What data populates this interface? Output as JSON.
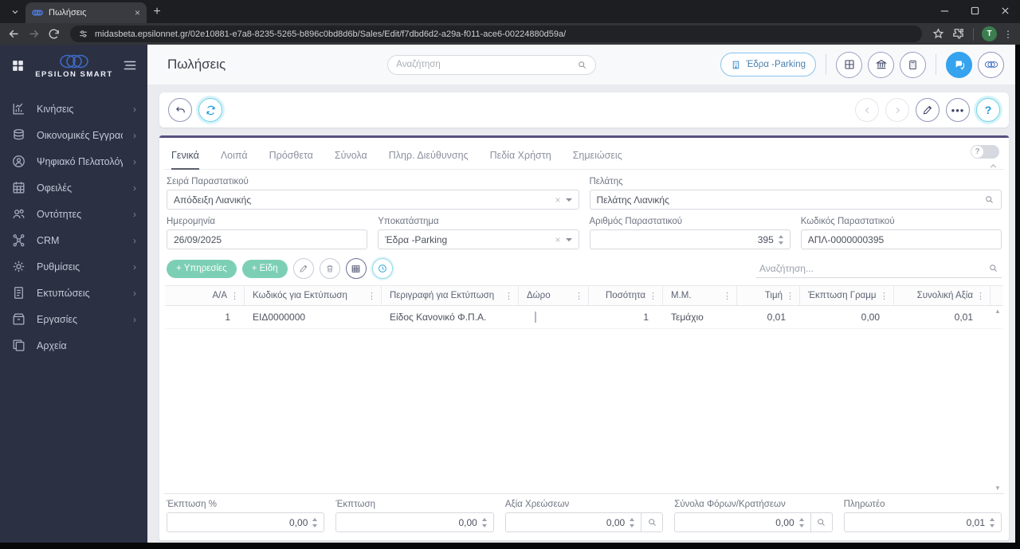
{
  "colors": {
    "accent_blue": "#35a3ee",
    "teal": "#7ccfb4",
    "sidebar_bg": "#2b3043",
    "purple_border": "#55517e"
  },
  "browser": {
    "tab_title": "Πωλήσεις",
    "url": "midasbeta.epsilonnet.gr/02e10881-e7a8-8235-5265-b896c0bd8d6b/Sales/Edit/f7dbd6d2-a29a-f011-ace6-00224880d59a/",
    "profile_initial": "T"
  },
  "sidebar": {
    "brand": "EPSILON SMART",
    "items": [
      {
        "label": "Κινήσεις"
      },
      {
        "label": "Οικονομικές Εγγραφές"
      },
      {
        "label": "Ψηφιακό Πελατολόγιο"
      },
      {
        "label": "Οφειλές"
      },
      {
        "label": "Οντότητες"
      },
      {
        "label": "CRM"
      },
      {
        "label": "Ρυθμίσεις"
      },
      {
        "label": "Εκτυπώσεις"
      },
      {
        "label": "Εργασίες"
      },
      {
        "label": "Αρχεία"
      }
    ]
  },
  "header": {
    "title": "Πωλήσεις",
    "search_placeholder": "Αναζήτηση",
    "branch_button": "Έδρα -Parking"
  },
  "tabs": [
    {
      "label": "Γενικά"
    },
    {
      "label": "Λοιπά"
    },
    {
      "label": "Πρόσθετα"
    },
    {
      "label": "Σύνολα"
    },
    {
      "label": "Πληρ. Διεύθυνσης"
    },
    {
      "label": "Πεδία Χρήστη"
    },
    {
      "label": "Σημειώσεις"
    }
  ],
  "fields": {
    "series": {
      "label": "Σειρά Παραστατικού",
      "value": "Απόδειξη Λιανικής"
    },
    "customer": {
      "label": "Πελάτης",
      "value": "Πελάτης Λιανικής"
    },
    "date": {
      "label": "Ημερομηνία",
      "value": "26/09/2025"
    },
    "branch": {
      "label": "Υποκατάστημα",
      "value": "Έδρα -Parking"
    },
    "doc_number": {
      "label": "Αριθμός Παραστατικού",
      "value": "395"
    },
    "doc_code": {
      "label": "Κωδικός Παραστατικού",
      "value": "ΑΠΛ-0000000395"
    }
  },
  "grid": {
    "add_services_label": "+ Υπηρεσίες",
    "add_items_label": "+ Είδη",
    "search_placeholder": "Αναζήτηση...",
    "columns": [
      "Α/Α",
      "Κωδικός για Εκτύπωση",
      "Περιγραφή για Εκτύπωση",
      "Δώρο",
      "Ποσότητα",
      "Μ.Μ.",
      "Τιμή",
      "Έκπτωση Γραμμή...",
      "Συνολική Αξία"
    ],
    "rows": [
      {
        "aa": "1",
        "code": "ΕΙΔ0000000",
        "description": "Είδος Κανονικό Φ.Π.Α.",
        "gift": false,
        "quantity": "1",
        "unit": "Τεμάχιο",
        "price": "0,01",
        "line_discount": "0,00",
        "total_value": "0,01"
      }
    ]
  },
  "totals": {
    "discount_pct": {
      "label": "Έκπτωση %",
      "value": "0,00"
    },
    "discount": {
      "label": "Έκπτωση",
      "value": "0,00"
    },
    "charges": {
      "label": "Αξία Χρεώσεων",
      "value": "0,00"
    },
    "taxes": {
      "label": "Σύνολα Φόρων/Κρατήσεων",
      "value": "0,00"
    },
    "payable": {
      "label": "Πληρωτέο",
      "value": "0,01"
    }
  }
}
